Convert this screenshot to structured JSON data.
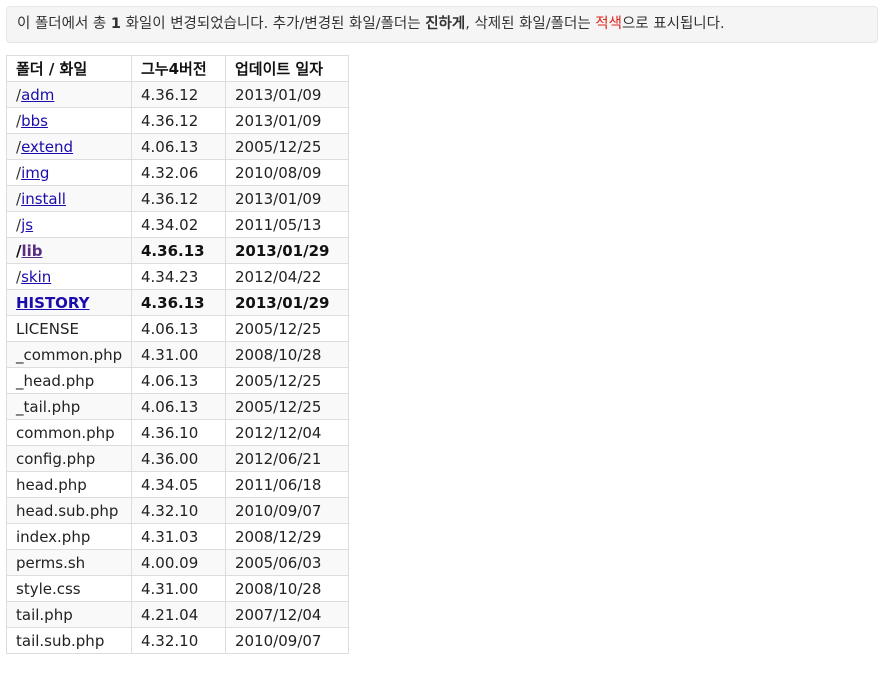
{
  "notice": {
    "part1": "이 폴더에서 총 ",
    "count": "1",
    "part2": " 화일이 변경되었습니다. 추가/변경된 화일/폴더는 ",
    "bold_word": "진하게",
    "part3": ", 삭제된 화일/폴더는 ",
    "red_word": "적색",
    "part4": "으로 표시됩니다."
  },
  "table": {
    "headers": [
      "폴더 / 화일",
      "그누4버전",
      "업데이트 일자"
    ],
    "rows": [
      {
        "prefix": "/",
        "name": "adm",
        "link": true,
        "version": "4.36.12",
        "date": "2013/01/09",
        "changed": false
      },
      {
        "prefix": "/",
        "name": "bbs",
        "link": true,
        "version": "4.36.12",
        "date": "2013/01/09",
        "changed": false
      },
      {
        "prefix": "/",
        "name": "extend",
        "link": true,
        "version": "4.06.13",
        "date": "2005/12/25",
        "changed": false
      },
      {
        "prefix": "/",
        "name": "img",
        "link": true,
        "version": "4.32.06",
        "date": "2010/08/09",
        "changed": false
      },
      {
        "prefix": "/",
        "name": "install",
        "link": true,
        "version": "4.36.12",
        "date": "2013/01/09",
        "changed": false
      },
      {
        "prefix": "/",
        "name": "js",
        "link": true,
        "version": "4.34.02",
        "date": "2011/05/13",
        "changed": false
      },
      {
        "prefix": "/",
        "name": "lib",
        "link": true,
        "version": "4.36.13",
        "date": "2013/01/29",
        "changed": true
      },
      {
        "prefix": "/",
        "name": "skin",
        "link": true,
        "version": "4.34.23",
        "date": "2012/04/22",
        "changed": false
      },
      {
        "prefix": "",
        "name": "HISTORY",
        "link": true,
        "version": "4.36.13",
        "date": "2013/01/29",
        "changed": true
      },
      {
        "prefix": "",
        "name": "LICENSE",
        "link": false,
        "version": "4.06.13",
        "date": "2005/12/25",
        "changed": false
      },
      {
        "prefix": "",
        "name": "_common.php",
        "link": false,
        "version": "4.31.00",
        "date": "2008/10/28",
        "changed": false
      },
      {
        "prefix": "",
        "name": "_head.php",
        "link": false,
        "version": "4.06.13",
        "date": "2005/12/25",
        "changed": false
      },
      {
        "prefix": "",
        "name": "_tail.php",
        "link": false,
        "version": "4.06.13",
        "date": "2005/12/25",
        "changed": false
      },
      {
        "prefix": "",
        "name": "common.php",
        "link": false,
        "version": "4.36.10",
        "date": "2012/12/04",
        "changed": false
      },
      {
        "prefix": "",
        "name": "config.php",
        "link": false,
        "version": "4.36.00",
        "date": "2012/06/21",
        "changed": false
      },
      {
        "prefix": "",
        "name": "head.php",
        "link": false,
        "version": "4.34.05",
        "date": "2011/06/18",
        "changed": false
      },
      {
        "prefix": "",
        "name": "head.sub.php",
        "link": false,
        "version": "4.32.10",
        "date": "2010/09/07",
        "changed": false
      },
      {
        "prefix": "",
        "name": "index.php",
        "link": false,
        "version": "4.31.03",
        "date": "2008/12/29",
        "changed": false
      },
      {
        "prefix": "",
        "name": "perms.sh",
        "link": false,
        "version": "4.00.09",
        "date": "2005/06/03",
        "changed": false
      },
      {
        "prefix": "",
        "name": "style.css",
        "link": false,
        "version": "4.31.00",
        "date": "2008/10/28",
        "changed": false
      },
      {
        "prefix": "",
        "name": "tail.php",
        "link": false,
        "version": "4.21.04",
        "date": "2007/12/04",
        "changed": false
      },
      {
        "prefix": "",
        "name": "tail.sub.php",
        "link": false,
        "version": "4.32.10",
        "date": "2010/09/07",
        "changed": false
      }
    ]
  }
}
